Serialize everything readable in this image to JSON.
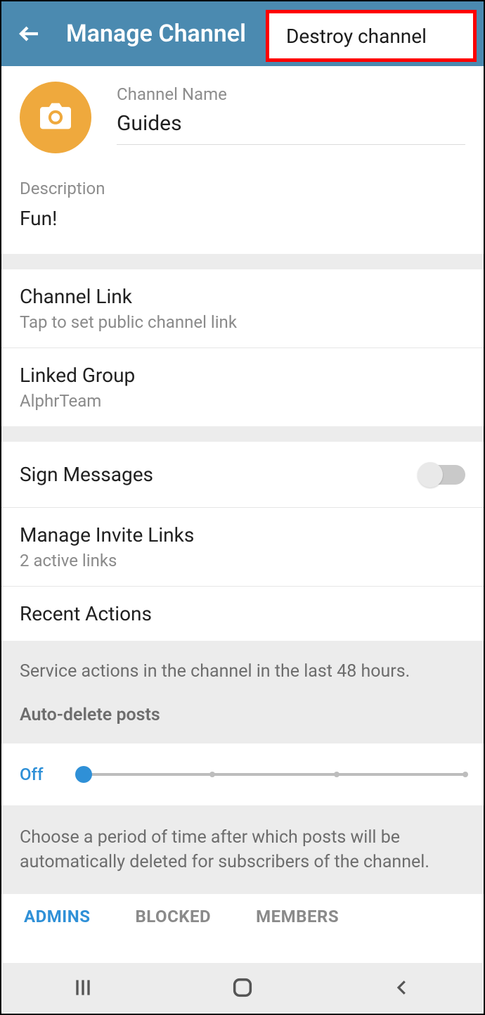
{
  "header": {
    "title": "Manage Channel",
    "destroy_label": "Destroy channel"
  },
  "channel_name": {
    "label": "Channel Name",
    "value": "Guides"
  },
  "description": {
    "label": "Description",
    "value": "Fun!"
  },
  "channel_link": {
    "title": "Channel Link",
    "sub": "Tap to set public channel link"
  },
  "linked_group": {
    "title": "Linked Group",
    "sub": "AlphrTeam"
  },
  "sign_messages": {
    "title": "Sign Messages"
  },
  "invite_links": {
    "title": "Manage Invite Links",
    "sub": "2 active links"
  },
  "recent_actions": {
    "title": "Recent Actions"
  },
  "service_info": "Service actions in the channel in the last 48 hours.",
  "auto_delete_heading": "Auto-delete posts",
  "auto_delete_value": "Off",
  "auto_delete_info": "Choose a period of time after which posts will be automatically deleted for subscribers of the channel.",
  "tabs": {
    "admins": "ADMINS",
    "blocked": "BLOCKED",
    "members": "MEMBERS"
  }
}
